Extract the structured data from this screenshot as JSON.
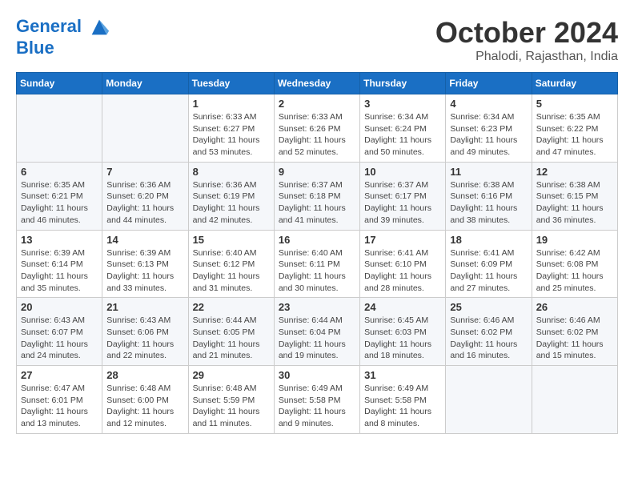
{
  "header": {
    "logo_line1": "General",
    "logo_line2": "Blue",
    "month": "October 2024",
    "location": "Phalodi, Rajasthan, India"
  },
  "days_of_week": [
    "Sunday",
    "Monday",
    "Tuesday",
    "Wednesday",
    "Thursday",
    "Friday",
    "Saturday"
  ],
  "weeks": [
    [
      {
        "day": "",
        "content": ""
      },
      {
        "day": "",
        "content": ""
      },
      {
        "day": "1",
        "content": "Sunrise: 6:33 AM\nSunset: 6:27 PM\nDaylight: 11 hours and 53 minutes."
      },
      {
        "day": "2",
        "content": "Sunrise: 6:33 AM\nSunset: 6:26 PM\nDaylight: 11 hours and 52 minutes."
      },
      {
        "day": "3",
        "content": "Sunrise: 6:34 AM\nSunset: 6:24 PM\nDaylight: 11 hours and 50 minutes."
      },
      {
        "day": "4",
        "content": "Sunrise: 6:34 AM\nSunset: 6:23 PM\nDaylight: 11 hours and 49 minutes."
      },
      {
        "day": "5",
        "content": "Sunrise: 6:35 AM\nSunset: 6:22 PM\nDaylight: 11 hours and 47 minutes."
      }
    ],
    [
      {
        "day": "6",
        "content": "Sunrise: 6:35 AM\nSunset: 6:21 PM\nDaylight: 11 hours and 46 minutes."
      },
      {
        "day": "7",
        "content": "Sunrise: 6:36 AM\nSunset: 6:20 PM\nDaylight: 11 hours and 44 minutes."
      },
      {
        "day": "8",
        "content": "Sunrise: 6:36 AM\nSunset: 6:19 PM\nDaylight: 11 hours and 42 minutes."
      },
      {
        "day": "9",
        "content": "Sunrise: 6:37 AM\nSunset: 6:18 PM\nDaylight: 11 hours and 41 minutes."
      },
      {
        "day": "10",
        "content": "Sunrise: 6:37 AM\nSunset: 6:17 PM\nDaylight: 11 hours and 39 minutes."
      },
      {
        "day": "11",
        "content": "Sunrise: 6:38 AM\nSunset: 6:16 PM\nDaylight: 11 hours and 38 minutes."
      },
      {
        "day": "12",
        "content": "Sunrise: 6:38 AM\nSunset: 6:15 PM\nDaylight: 11 hours and 36 minutes."
      }
    ],
    [
      {
        "day": "13",
        "content": "Sunrise: 6:39 AM\nSunset: 6:14 PM\nDaylight: 11 hours and 35 minutes."
      },
      {
        "day": "14",
        "content": "Sunrise: 6:39 AM\nSunset: 6:13 PM\nDaylight: 11 hours and 33 minutes."
      },
      {
        "day": "15",
        "content": "Sunrise: 6:40 AM\nSunset: 6:12 PM\nDaylight: 11 hours and 31 minutes."
      },
      {
        "day": "16",
        "content": "Sunrise: 6:40 AM\nSunset: 6:11 PM\nDaylight: 11 hours and 30 minutes."
      },
      {
        "day": "17",
        "content": "Sunrise: 6:41 AM\nSunset: 6:10 PM\nDaylight: 11 hours and 28 minutes."
      },
      {
        "day": "18",
        "content": "Sunrise: 6:41 AM\nSunset: 6:09 PM\nDaylight: 11 hours and 27 minutes."
      },
      {
        "day": "19",
        "content": "Sunrise: 6:42 AM\nSunset: 6:08 PM\nDaylight: 11 hours and 25 minutes."
      }
    ],
    [
      {
        "day": "20",
        "content": "Sunrise: 6:43 AM\nSunset: 6:07 PM\nDaylight: 11 hours and 24 minutes."
      },
      {
        "day": "21",
        "content": "Sunrise: 6:43 AM\nSunset: 6:06 PM\nDaylight: 11 hours and 22 minutes."
      },
      {
        "day": "22",
        "content": "Sunrise: 6:44 AM\nSunset: 6:05 PM\nDaylight: 11 hours and 21 minutes."
      },
      {
        "day": "23",
        "content": "Sunrise: 6:44 AM\nSunset: 6:04 PM\nDaylight: 11 hours and 19 minutes."
      },
      {
        "day": "24",
        "content": "Sunrise: 6:45 AM\nSunset: 6:03 PM\nDaylight: 11 hours and 18 minutes."
      },
      {
        "day": "25",
        "content": "Sunrise: 6:46 AM\nSunset: 6:02 PM\nDaylight: 11 hours and 16 minutes."
      },
      {
        "day": "26",
        "content": "Sunrise: 6:46 AM\nSunset: 6:02 PM\nDaylight: 11 hours and 15 minutes."
      }
    ],
    [
      {
        "day": "27",
        "content": "Sunrise: 6:47 AM\nSunset: 6:01 PM\nDaylight: 11 hours and 13 minutes."
      },
      {
        "day": "28",
        "content": "Sunrise: 6:48 AM\nSunset: 6:00 PM\nDaylight: 11 hours and 12 minutes."
      },
      {
        "day": "29",
        "content": "Sunrise: 6:48 AM\nSunset: 5:59 PM\nDaylight: 11 hours and 11 minutes."
      },
      {
        "day": "30",
        "content": "Sunrise: 6:49 AM\nSunset: 5:58 PM\nDaylight: 11 hours and 9 minutes."
      },
      {
        "day": "31",
        "content": "Sunrise: 6:49 AM\nSunset: 5:58 PM\nDaylight: 11 hours and 8 minutes."
      },
      {
        "day": "",
        "content": ""
      },
      {
        "day": "",
        "content": ""
      }
    ]
  ]
}
